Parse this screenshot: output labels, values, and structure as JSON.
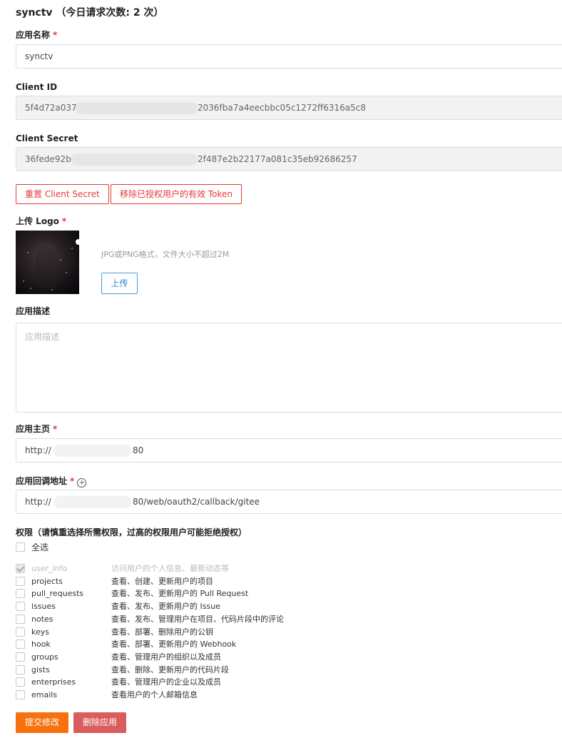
{
  "header": {
    "title": "synctv （今日请求次数: 2 次）"
  },
  "app_name": {
    "label": "应用名称",
    "required": "*",
    "value": "synctv"
  },
  "client_id": {
    "label": "Client ID",
    "value_prefix": "5f4d72a037",
    "value_suffix": "2036fba7a4eecbbc05c1272ff6316a5c8"
  },
  "client_secret": {
    "label": "Client Secret",
    "value_prefix": "36fede92b",
    "value_suffix": "2f487e2b22177a081c35eb92686257"
  },
  "actions": {
    "reset_secret": "重置 Client Secret",
    "revoke_tokens": "移除已授权用户的有效 Token"
  },
  "logo": {
    "label": "上传 Logo",
    "required": "*",
    "hint": "JPG或PNG格式，文件大小不超过2M",
    "upload": "上传"
  },
  "description": {
    "label": "应用描述",
    "placeholder": "应用描述"
  },
  "homepage": {
    "label": "应用主页",
    "required": "*",
    "value_prefix": "http://",
    "value_suffix": "80"
  },
  "callback": {
    "label": "应用回调地址",
    "required": "*",
    "plus_icon": "+",
    "value_prefix": "http://",
    "value_suffix": "80/web/oauth2/callback/gitee"
  },
  "permissions": {
    "label": "权限（请慎重选择所需权限，过高的权限用户可能拒绝授权）",
    "select_all": "全选",
    "items": [
      {
        "name": "user_info",
        "desc": "访问用户的个人信息、最新动态等",
        "checked": true,
        "disabled": true
      },
      {
        "name": "projects",
        "desc": "查看、创建、更新用户的项目",
        "checked": false
      },
      {
        "name": "pull_requests",
        "desc": "查看、发布、更新用户的 Pull Request",
        "checked": false
      },
      {
        "name": "issues",
        "desc": "查看、发布、更新用户的 Issue",
        "checked": false
      },
      {
        "name": "notes",
        "desc": "查看、发布、管理用户在项目、代码片段中的评论",
        "checked": false
      },
      {
        "name": "keys",
        "desc": "查看、部署、删除用户的公钥",
        "checked": false
      },
      {
        "name": "hook",
        "desc": "查看、部署、更新用户的 Webhook",
        "checked": false
      },
      {
        "name": "groups",
        "desc": "查看、管理用户的组织以及成员",
        "checked": false
      },
      {
        "name": "gists",
        "desc": "查看、删除、更新用户的代码片段",
        "checked": false
      },
      {
        "name": "enterprises",
        "desc": "查看、管理用户的企业以及成员",
        "checked": false
      },
      {
        "name": "emails",
        "desc": "查看用户的个人邮箱信息",
        "checked": false
      }
    ]
  },
  "footer": {
    "submit": "提交修改",
    "delete": "删除应用"
  },
  "colors": {
    "primary": "#f5720f",
    "danger": "#da5d5d",
    "outline_danger": "#e53935",
    "link_blue": "#2f86cf"
  }
}
